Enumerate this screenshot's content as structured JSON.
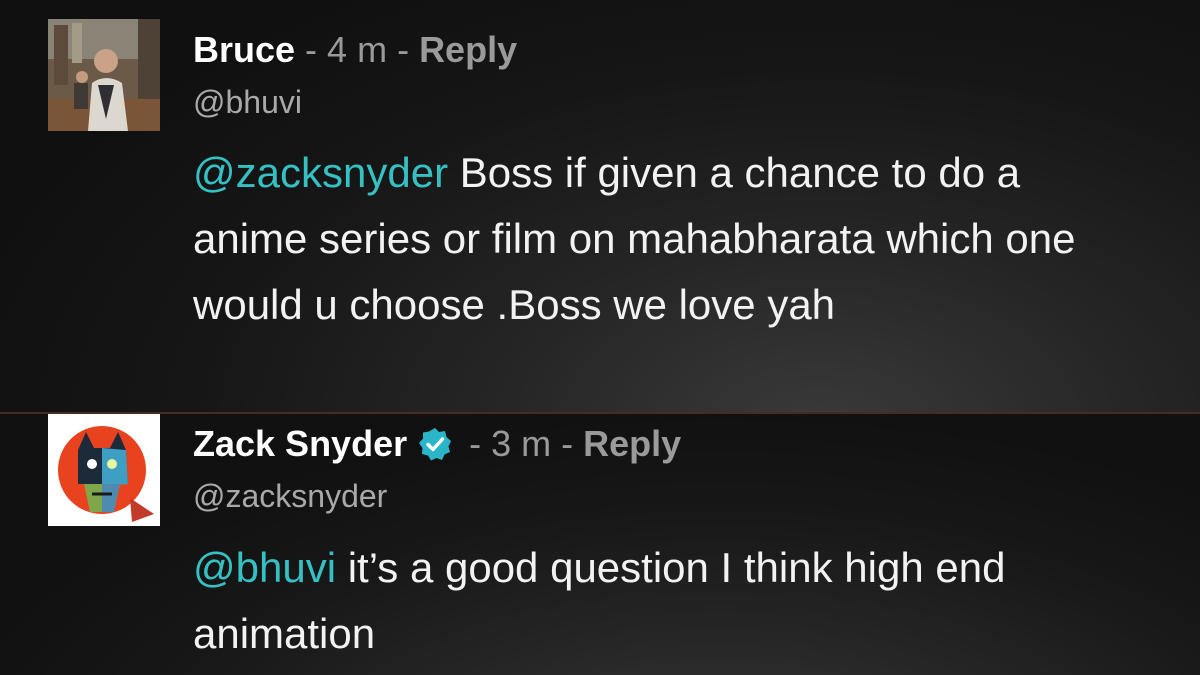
{
  "comments": [
    {
      "author": "Bruce",
      "time_sep": " - ",
      "time": "4 m",
      "reply_sep": " - ",
      "reply_label": "Reply",
      "handle": "@bhuvi",
      "mention": "@zacksnyder",
      "text": " Boss if given a chance to do a anime series or film on mahabharata which one would u choose .Boss we love yah",
      "verified": false
    },
    {
      "author": "Zack Snyder",
      "time_sep": " - ",
      "time": "3 m",
      "reply_sep": " - ",
      "reply_label": "Reply",
      "handle": "@zacksnyder",
      "mention": "@bhuvi",
      "text": " it’s a good question I think high end animation",
      "verified": true
    }
  ],
  "colors": {
    "mention": "#35c1c4",
    "verified_badge": "#2bb5c9",
    "meta_text": "#9a9a9a"
  },
  "icons": {
    "verified": "verified-badge-icon",
    "avatar_bruce": "photo-avatar",
    "avatar_zack": "illustrated-avatar"
  }
}
